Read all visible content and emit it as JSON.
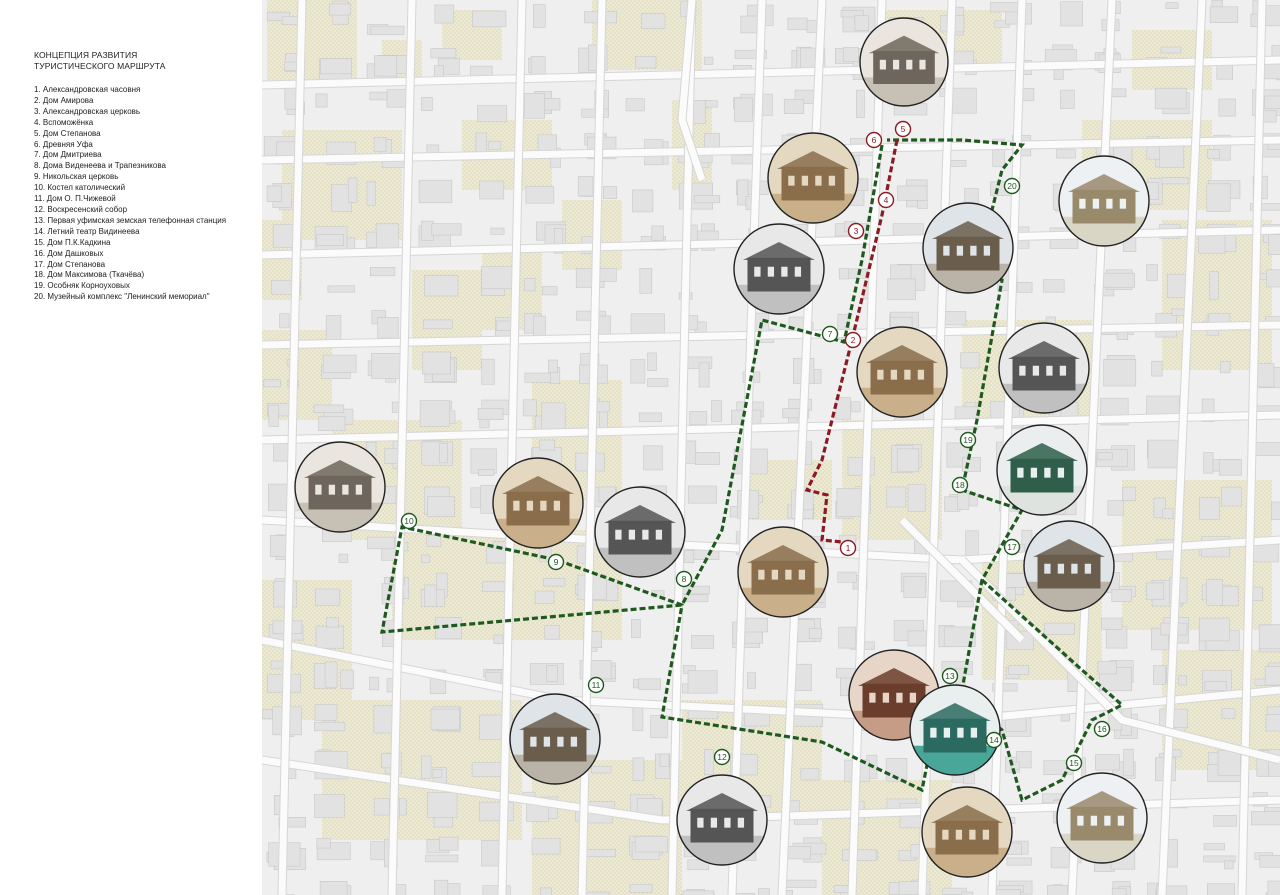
{
  "legend": {
    "title_line1": "КОНЦЕПЦИЯ РАЗВИТИЯ",
    "title_line2": "ТУРИСТИЧЕСКОГО МАРШРУТА",
    "items": [
      "1. Александровская часовня",
      "2. Дом Амирова",
      "3. Александровская церковь",
      "4. Вспоможёнка",
      "5. Дом Степанова",
      "6. Древняя Уфа",
      "7. Дом Дмитриева",
      "8. Дома Виденеева и Трапезникова",
      "9. Никольская церковь",
      "10. Костел католический",
      "11. Дом О. П.Чижевой",
      "12. Воскресенский собор",
      "13. Первая уфимская земская телефонная станция",
      "14. Летний театр Видинеева",
      "15. Дом П.К.Кадкина",
      "16. Дом Дашковых",
      "17. Дом Степанова",
      "18. Дом Максимова (Ткачёва)",
      "19. Особняк Корноуховых",
      "20. Музейный комплекс \"Ленинский мемориал\""
    ]
  },
  "map": {
    "colors": {
      "background": "#efefef",
      "block": "#e2e2e2",
      "block_stroke": "#c8c8c8",
      "green_area": "#ebe8d2",
      "road": "#fbfbfb",
      "green_route": "#1e5a1e",
      "red_route": "#8c1a22"
    },
    "red_markers": [
      "1",
      "2",
      "3",
      "4",
      "5",
      "6"
    ],
    "green_markers": [
      "7",
      "8",
      "9",
      "10",
      "11",
      "12",
      "13",
      "14",
      "15",
      "16",
      "17",
      "18",
      "19",
      "20"
    ],
    "photos": [
      {
        "name": "drevnyaya-ufa-photo",
        "tone": "sepia-gray"
      },
      {
        "name": "aleksandrovskaya-tserkov-photo",
        "tone": "sepia"
      },
      {
        "name": "dom-stepanova-photo",
        "tone": "gray"
      },
      {
        "name": "dom-dmitrieva-photo",
        "tone": "color-muted"
      },
      {
        "name": "muzey-leninskiy-memorial-photo",
        "tone": "color-light"
      },
      {
        "name": "dom-amirova-photo",
        "tone": "sepia"
      },
      {
        "name": "osobnyak-kornouhovyh-photo",
        "tone": "gray"
      },
      {
        "name": "dom-maksimova-photo",
        "tone": "color-green"
      },
      {
        "name": "kostel-photo",
        "tone": "sepia-gray"
      },
      {
        "name": "nikolskaya-tserkov-photo",
        "tone": "sepia"
      },
      {
        "name": "doma-videneeva-photo",
        "tone": "gray"
      },
      {
        "name": "aleksandrovskaya-chasovnya-photo",
        "tone": "sepia"
      },
      {
        "name": "dom-stepanova-17-photo",
        "tone": "color-muted"
      },
      {
        "name": "telefonnaya-stantsiya-photo",
        "tone": "sepia-red"
      },
      {
        "name": "dom-chizhevoy-photo",
        "tone": "color-muted"
      },
      {
        "name": "dom-dashkovyh-photo",
        "tone": "color-teal"
      },
      {
        "name": "voskresenskiy-sobor-photo",
        "tone": "gray"
      },
      {
        "name": "letniy-teatr-photo",
        "tone": "sepia"
      },
      {
        "name": "dom-kadkina-photo",
        "tone": "color-light"
      }
    ]
  }
}
